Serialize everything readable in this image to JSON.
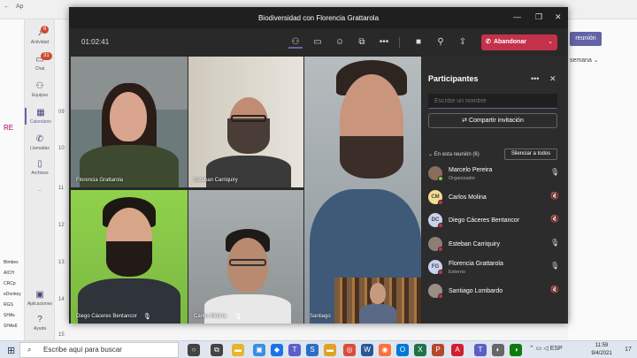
{
  "background": {
    "left_texts": [
      "RE",
      "Bimbes",
      "AICH",
      "CRCp",
      "eDonkey",
      "RGS",
      "SHAs",
      "SHAs6"
    ],
    "hour_labels": [
      "09",
      "10",
      "11",
      "12",
      "13",
      "14",
      "15"
    ],
    "new_meeting_label": "reunión",
    "week_label": "semana",
    "tab_label": "Ap"
  },
  "rail": {
    "items": [
      {
        "label": "Actividad",
        "badge": "6",
        "icon": "bell-icon"
      },
      {
        "label": "Chat",
        "badge": "31",
        "icon": "chat-icon"
      },
      {
        "label": "Equipos",
        "badge": "",
        "icon": "teams-icon"
      },
      {
        "label": "Calendario",
        "badge": "",
        "icon": "calendar-icon"
      },
      {
        "label": "Llamadas",
        "badge": "",
        "icon": "phone-icon"
      },
      {
        "label": "Archivos",
        "badge": "",
        "icon": "file-icon"
      },
      {
        "label": "...",
        "badge": "",
        "icon": "more-icon"
      },
      {
        "label": "Aplicaciones",
        "badge": "",
        "icon": "apps-icon"
      },
      {
        "label": "Ayuda",
        "badge": "",
        "icon": "help-icon"
      }
    ]
  },
  "window": {
    "title": "Biodiversidad con Florencia Grattarola",
    "timer": "01:02:41",
    "leave_label": "Abandonar"
  },
  "tiles": [
    {
      "name": "Florencia Grattarola"
    },
    {
      "name": "Esteban Carriquiry"
    },
    {
      "name": "Diego Cáceres Bentancor"
    },
    {
      "name": "Carlos Molina"
    },
    {
      "name": "Santiago"
    }
  ],
  "participants": {
    "title": "Participantes",
    "search_placeholder": "Escribe un nombre",
    "share_label": "Compartir invitación",
    "in_meeting_label": "En esta reunión (6)",
    "mute_all_label": "Silenciar a todos",
    "list": [
      {
        "name": "Marcelo Pereira",
        "sub": "Organizador",
        "initials": "",
        "avatar_color": "#8a6d5a",
        "status_color": "#92c353",
        "muted": false
      },
      {
        "name": "Carlos Molina",
        "sub": "",
        "initials": "CM",
        "avatar_color": "#f2e08f",
        "status_color": "#c4314b",
        "muted": true
      },
      {
        "name": "Diego Cáceres Bentancor",
        "sub": "",
        "initials": "DC",
        "avatar_color": "#c9d3ef",
        "status_color": "#c4314b",
        "muted": true
      },
      {
        "name": "Esteban Carriquiry",
        "sub": "",
        "initials": "",
        "avatar_color": "#8d7f73",
        "status_color": "#c4314b",
        "muted": false
      },
      {
        "name": "Florencia Grattarola",
        "sub": "Externo",
        "initials": "FG",
        "avatar_color": "#c9d3ef",
        "status_color": "#c4314b",
        "muted": false
      },
      {
        "name": "Santiago Lombardo",
        "sub": "",
        "initials": "",
        "avatar_color": "#9b8e86",
        "status_color": "#c4314b",
        "muted": true
      }
    ]
  },
  "taskbar": {
    "search_placeholder": "Escribe aquí para buscar",
    "tray_lang": "ESP",
    "time": "11:59",
    "date": "9/4/2021",
    "notifications": "17"
  },
  "colors": {
    "accent": "#6264a7",
    "leave": "#c4314b",
    "window_bg": "#292929"
  }
}
